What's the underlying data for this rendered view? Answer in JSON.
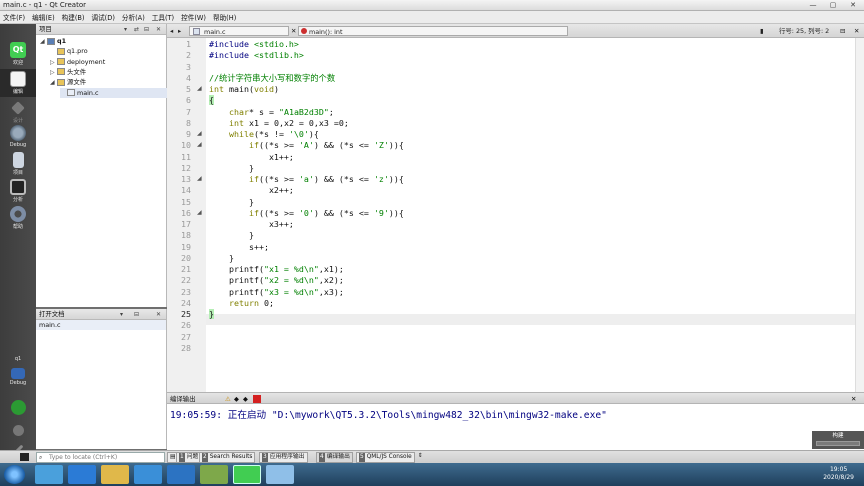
{
  "window": {
    "title": "main.c - q1 - Qt Creator",
    "controls": [
      "—",
      "▢",
      "✕"
    ]
  },
  "menu": [
    "文件(F)",
    "编辑(E)",
    "构建(B)",
    "调试(D)",
    "分析(A)",
    "工具(T)",
    "控件(W)",
    "帮助(H)"
  ],
  "modes": [
    {
      "label": "欢迎"
    },
    {
      "label": "编辑"
    },
    {
      "label": "设计"
    },
    {
      "label": "Debug"
    },
    {
      "label": "项目"
    },
    {
      "label": "分析"
    },
    {
      "label": "帮助"
    }
  ],
  "kit": {
    "project": "q1",
    "config": "Debug"
  },
  "projects_panel": {
    "title": "项目",
    "tree": [
      {
        "label": "q1",
        "indent": 0,
        "arrow": "◢",
        "bold": true
      },
      {
        "label": "q1.pro",
        "indent": 1,
        "arrow": ""
      },
      {
        "label": "deployment",
        "indent": 1,
        "arrow": "▷"
      },
      {
        "label": "头文件",
        "indent": 1,
        "arrow": "▷"
      },
      {
        "label": "源文件",
        "indent": 1,
        "arrow": "◢"
      },
      {
        "label": "main.c",
        "indent": 2,
        "arrow": "",
        "selected": true
      }
    ]
  },
  "open_docs": {
    "title": "打开文档",
    "items": [
      "main.c"
    ]
  },
  "editor_toolbar": {
    "file": "main.c",
    "symbol": "main(): int",
    "line_info": "行号: 25, 列号: 2"
  },
  "editor": {
    "current_line": 25,
    "lines": [
      {
        "n": 1,
        "text": "#include <stdio.h>"
      },
      {
        "n": 2,
        "text": "#include <stdlib.h>"
      },
      {
        "n": 3,
        "text": ""
      },
      {
        "n": 4,
        "text": "//统计字符串大小写和数字的个数"
      },
      {
        "n": 5,
        "text": "int main(void)"
      },
      {
        "n": 6,
        "text": "{"
      },
      {
        "n": 7,
        "text": "    char* s = \"A1aB2d3D\";"
      },
      {
        "n": 8,
        "text": "    int x1 = 0,x2 = 0,x3 =0;"
      },
      {
        "n": 9,
        "text": "    while(*s != '\\0'){"
      },
      {
        "n": 10,
        "text": "        if((*s >= 'A') && (*s <= 'Z')){"
      },
      {
        "n": 11,
        "text": "            x1++;"
      },
      {
        "n": 12,
        "text": "        }"
      },
      {
        "n": 13,
        "text": "        if((*s >= 'a') && (*s <= 'z')){"
      },
      {
        "n": 14,
        "text": "            x2++;"
      },
      {
        "n": 15,
        "text": "        }"
      },
      {
        "n": 16,
        "text": "        if((*s >= '0') && (*s <= '9')){"
      },
      {
        "n": 17,
        "text": "            x3++;"
      },
      {
        "n": 18,
        "text": "        }"
      },
      {
        "n": 19,
        "text": "        s++;"
      },
      {
        "n": 20,
        "text": "    }"
      },
      {
        "n": 21,
        "text": "    printf(\"x1 = %d\\n\",x1);"
      },
      {
        "n": 22,
        "text": "    printf(\"x2 = %d\\n\",x2);"
      },
      {
        "n": 23,
        "text": "    printf(\"x3 = %d\\n\",x3);"
      },
      {
        "n": 24,
        "text": "    return 0;"
      },
      {
        "n": 25,
        "text": "}"
      },
      {
        "n": 26,
        "text": ""
      },
      {
        "n": 27,
        "text": ""
      },
      {
        "n": 28,
        "text": ""
      }
    ],
    "fold_markers_at": [
      5,
      9,
      10,
      13,
      16
    ]
  },
  "output_panel": {
    "title": "编译输出",
    "message": "19:05:59: 正在启动 \"D:\\mywork\\QT5.3.2\\Tools\\mingw482_32\\bin\\mingw32-make.exe\"",
    "build_label": "构建"
  },
  "status_bar": {
    "locator_placeholder": "Type to locate (Ctrl+K)",
    "tabs": [
      {
        "num": "1",
        "label": "问题"
      },
      {
        "num": "2",
        "label": "Search Results"
      },
      {
        "num": "3",
        "label": "应用程序输出"
      },
      {
        "num": "4",
        "label": "编译输出"
      },
      {
        "num": "5",
        "label": "QML/JS Console"
      }
    ]
  },
  "taskbar": {
    "time": "19:05",
    "date": "2020/8/29"
  }
}
